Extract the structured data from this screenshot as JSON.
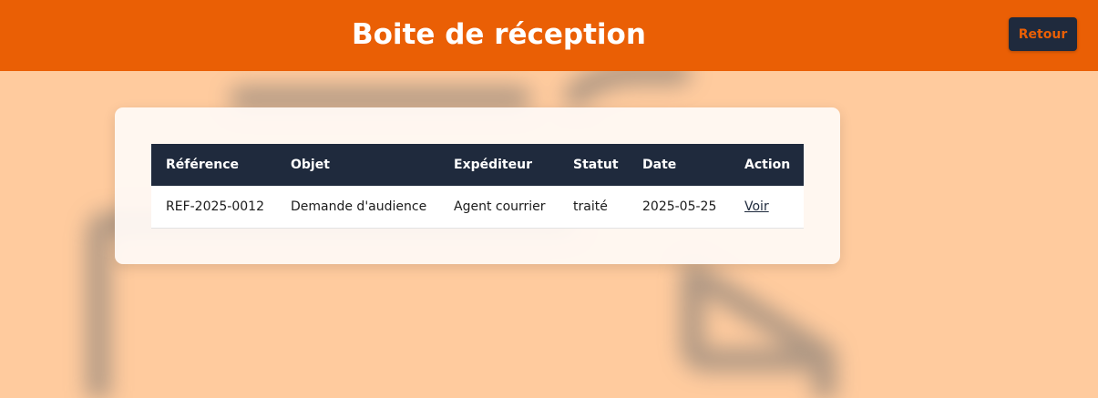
{
  "header": {
    "title": "Boite de réception",
    "back_label": "Retour"
  },
  "inbox": {
    "columns": [
      "Référence",
      "Objet",
      "Expéditeur",
      "Statut",
      "Date",
      "Action"
    ],
    "rows": [
      {
        "reference": "REF-2025-0012",
        "objet": "Demande d'audience",
        "expediteur": "Agent courrier",
        "statut": "traité",
        "date": "2025-05-25",
        "action": "Voir"
      }
    ]
  },
  "colors": {
    "header_bg": "#ea5f05",
    "page_bg": "#ffcb9e",
    "table_header_bg": "#1f2a3d",
    "button_bg": "#1f2a3d",
    "button_text": "#ea5f05"
  },
  "background_icon": "document-icon"
}
